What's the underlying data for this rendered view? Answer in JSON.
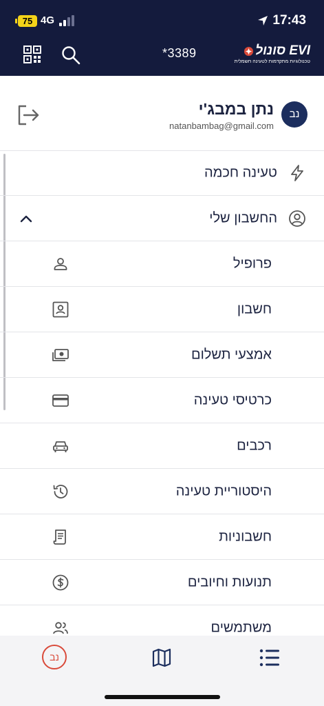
{
  "status_bar": {
    "battery": "75",
    "network": "4G",
    "time": "17:43"
  },
  "header": {
    "account_number": "*3389",
    "logo_main": "סונול EVI",
    "logo_tagline": "טכנולוגיות מתקדמות לטעינה חשמלית"
  },
  "user": {
    "name": "נתן במבג'י",
    "email": "natanbambag@gmail.com",
    "initials": "נב"
  },
  "menu": {
    "smart_charging": "טעינה חכמה",
    "my_account": "החשבון שלי",
    "items": [
      {
        "label": "פרופיל",
        "icon": "user-icon"
      },
      {
        "label": "חשבון",
        "icon": "account-card-icon"
      },
      {
        "label": "אמצעי תשלום",
        "icon": "cash-icon"
      },
      {
        "label": "כרטיסי טעינה",
        "icon": "credit-card-icon"
      },
      {
        "label": "רכבים",
        "icon": "car-icon"
      },
      {
        "label": "היסטוריית טעינה",
        "icon": "history-icon"
      },
      {
        "label": "חשבוניות",
        "icon": "invoice-icon"
      },
      {
        "label": "תנועות וחיובים",
        "icon": "dollar-icon"
      },
      {
        "label": "משתמשים",
        "icon": "users-icon"
      }
    ]
  },
  "bottom_nav": {
    "avatar_initials": "נב"
  },
  "colors": {
    "header_bg": "#141b3d",
    "text": "#1c2340",
    "accent": "#d94a3a"
  }
}
